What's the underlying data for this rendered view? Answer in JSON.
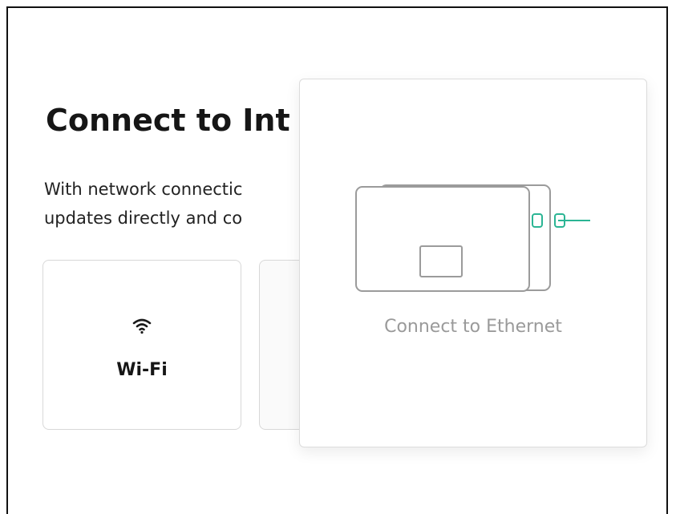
{
  "page": {
    "title": "Connect to Int",
    "description_line1": "With network connectic",
    "description_line2": "updates directly and co"
  },
  "options": {
    "wifi": {
      "label": "Wi-Fi",
      "icon": "wifi-icon"
    },
    "ethernet": {
      "caption": "Connect to Ethernet",
      "icon": "ethernet-cable-illustration"
    }
  },
  "colors": {
    "accent": "#2bb594",
    "outline": "#9b9b9b",
    "caption": "#9a9a9a"
  }
}
